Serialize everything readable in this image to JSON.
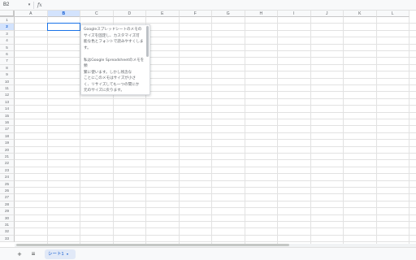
{
  "formula_bar": {
    "name_box": "B2",
    "name_box_arrow": "▾",
    "fx": "fx",
    "formula_value": ""
  },
  "columns": [
    "A",
    "B",
    "C",
    "D",
    "E",
    "F",
    "G",
    "H",
    "I",
    "J",
    "K",
    "L"
  ],
  "selected_column": "B",
  "rows": [
    "1",
    "2",
    "3",
    "4",
    "5",
    "6",
    "7",
    "8",
    "9",
    "10",
    "11",
    "12",
    "13",
    "14",
    "15",
    "16",
    "17",
    "18",
    "19",
    "20",
    "21",
    "22",
    "23",
    "24",
    "25",
    "26",
    "27",
    "28",
    "29",
    "30",
    "31",
    "32",
    "33"
  ],
  "selected_row": "2",
  "active_cell": "B2",
  "note": {
    "text": "Googleスプレッドシートのメモの\nサイズを固定し、カスタマイズ可\n能な色とフォントで読みやすくしま\nす。\n\n私はGoogle Spreadsheetのメモを頻\n繁に使います。しかし残念な\nことにこのメモはサイズが小さ\nく、リサイズしても一つの間にか\n元のサイズに戻ります。\n\nこれを解決するために、メモを大"
  },
  "tab_bar": {
    "add_sheet": "+",
    "all_sheets": "≡",
    "sheet_name": "シート1",
    "sheet_arrow": "▾"
  },
  "colors": {
    "accent": "#1a73e8",
    "selected_header_bg": "#d3e3fd",
    "gridline": "#e2e2e2",
    "sheet_tab_bg": "#e1e9f7"
  }
}
